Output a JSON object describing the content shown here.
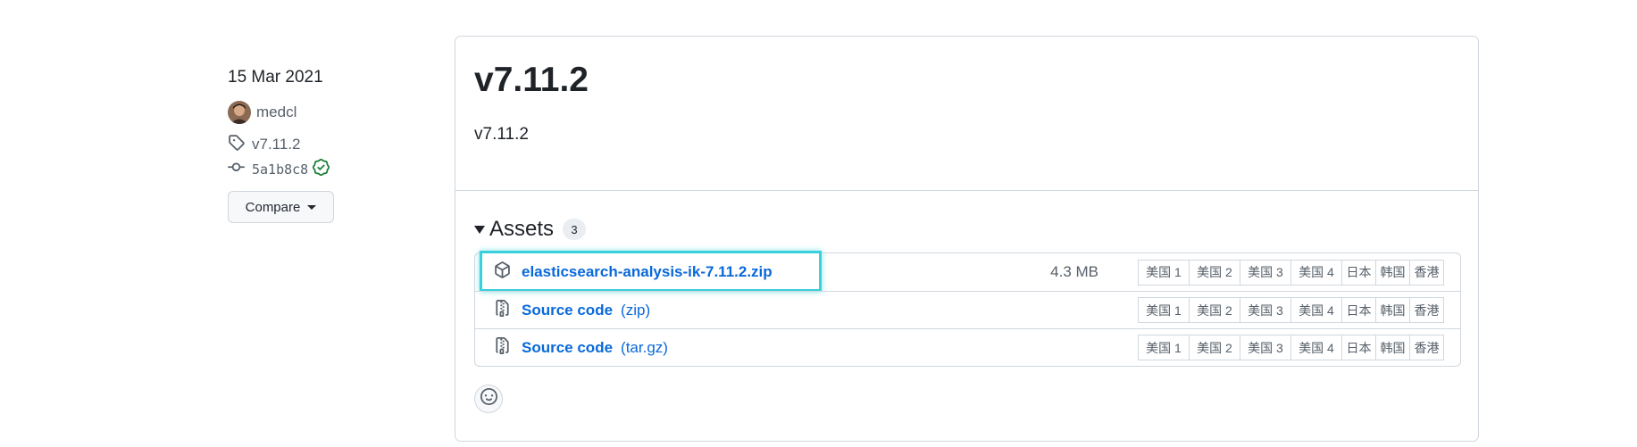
{
  "sidebar": {
    "date": "15 Mar 2021",
    "author": "medcl",
    "tag": "v7.11.2",
    "commit": "5a1b8c8",
    "compare_label": "Compare"
  },
  "release": {
    "title": "v7.11.2",
    "body": "v7.11.2"
  },
  "assets": {
    "title": "Assets",
    "count": "3",
    "items": [
      {
        "name": "elasticsearch-analysis-ik-7.11.2.zip",
        "suffix": "",
        "size": "4.3 MB",
        "icon": "package-icon",
        "highlighted": true
      },
      {
        "name": "Source code",
        "suffix": "(zip)",
        "size": "",
        "icon": "file-zip-icon",
        "highlighted": false
      },
      {
        "name": "Source code",
        "suffix": "(tar.gz)",
        "size": "",
        "icon": "file-zip-icon",
        "highlighted": false
      }
    ],
    "mirrors": [
      "美国 1",
      "美国 2",
      "美国 3",
      "美国 4",
      "日本",
      "韩国",
      "香港"
    ]
  },
  "reactions": {
    "icon": "smiley-icon"
  },
  "colors": {
    "link": "#0969da",
    "border": "#d0d7de",
    "highlight": "#3bd0db",
    "verified": "#1a7f37"
  }
}
